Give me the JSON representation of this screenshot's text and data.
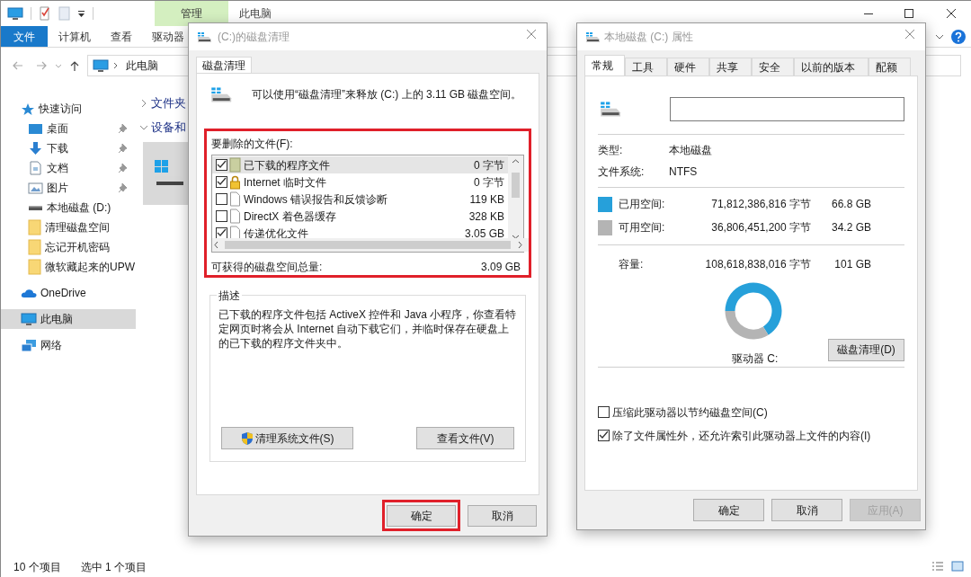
{
  "explorer": {
    "ribbon_header": {
      "context_group": "管理",
      "title": "此电脑"
    },
    "ribbon_tabs": [
      {
        "label": "文件",
        "kind": "file-menu"
      },
      {
        "label": "计算机",
        "kind": "tab"
      },
      {
        "label": "查看",
        "kind": "tab"
      },
      {
        "label": "驱动器",
        "kind": "tab"
      }
    ],
    "address": "此电脑",
    "nav": [
      {
        "label": "快速访问",
        "kind": "star",
        "selected": false,
        "children": [
          {
            "label": "桌面",
            "kind": "desktop",
            "pinned": true,
            "selected": false
          },
          {
            "label": "下载",
            "kind": "download",
            "pinned": true,
            "selected": false
          },
          {
            "label": "文档",
            "kind": "document",
            "pinned": true,
            "selected": false
          },
          {
            "label": "图片",
            "kind": "pictures",
            "pinned": true,
            "selected": false
          },
          {
            "label": "本地磁盘 (D:)",
            "kind": "drive",
            "pinned": false,
            "selected": false
          },
          {
            "label": "清理磁盘空间",
            "kind": "folder",
            "pinned": false,
            "selected": false
          },
          {
            "label": "忘记开机密码",
            "kind": "folder",
            "pinned": false,
            "selected": false
          },
          {
            "label": "微软藏起来的UPW",
            "kind": "folder",
            "pinned": false,
            "selected": false
          }
        ]
      },
      {
        "label": "OneDrive",
        "kind": "cloud",
        "selected": false
      },
      {
        "label": "此电脑",
        "kind": "pc",
        "selected": true
      },
      {
        "label": "网络",
        "kind": "network",
        "selected": false
      }
    ],
    "sections": [
      {
        "label": "文件夹",
        "expanded": false
      },
      {
        "label": "设备和",
        "expanded": true
      }
    ],
    "drive_tile": {
      "selected": true
    },
    "status": [
      "10 个项目",
      "选中 1 个项目"
    ]
  },
  "cleanup_dialog": {
    "title": "(C:)的磁盘清理",
    "tabs": [
      {
        "label": "磁盘清理",
        "selected": true
      }
    ],
    "summary": "可以使用“磁盘清理”来释放 (C:) 上的 3.11 GB 磁盘空间。",
    "files_highlighted": true,
    "files_label": "要删除的文件(F):",
    "files": [
      {
        "kind": "package",
        "name": "已下载的程序文件",
        "size": "0 字节",
        "checked": true,
        "selected": true
      },
      {
        "kind": "lock",
        "name": "Internet 临时文件",
        "size": "0 字节",
        "checked": true,
        "selected": false
      },
      {
        "kind": "file",
        "name": "Windows 错误报告和反馈诊断",
        "size": "119 KB",
        "checked": false,
        "selected": false
      },
      {
        "kind": "file",
        "name": "DirectX 着色器缓存",
        "size": "328 KB",
        "checked": false,
        "selected": false
      },
      {
        "kind": "file",
        "name": "传递优化文件",
        "size": "3.05 GB",
        "checked": true,
        "selected": false
      }
    ],
    "total_label": "可获得的磁盘空间总量:",
    "total": "3.09 GB",
    "description_title": "描述",
    "description": "已下载的程序文件包括 ActiveX 控件和 Java 小程序，你查看特定网页时将会从 Internet 自动下载它们，并临时保存在硬盘上的已下载的程序文件夹中。",
    "buttons": [
      {
        "label": "清理系统文件(S)",
        "kind": "shield"
      },
      {
        "label": "查看文件(V)",
        "kind": "plain"
      }
    ],
    "footer_buttons": [
      {
        "label": "确定",
        "highlighted": true
      },
      {
        "label": "取消",
        "highlighted": false
      }
    ]
  },
  "properties_dialog": {
    "title": "本地磁盘 (C:) 属性",
    "tabs": [
      {
        "label": "常规",
        "selected": true
      },
      {
        "label": "工具",
        "selected": false
      },
      {
        "label": "硬件",
        "selected": false
      },
      {
        "label": "共享",
        "selected": false
      },
      {
        "label": "安全",
        "selected": false
      },
      {
        "label": "以前的版本",
        "selected": false
      },
      {
        "label": "配额",
        "selected": false
      }
    ],
    "info": [
      {
        "label": "类型:",
        "value": "本地磁盘"
      },
      {
        "label": "文件系统:",
        "value": "NTFS"
      }
    ],
    "space": [
      {
        "label": "已用空间:",
        "bytes": "71,812,386,816 字节",
        "size": "66.8 GB",
        "color": "#26a0da"
      },
      {
        "label": "可用空间:",
        "bytes": "36,806,451,200 字节",
        "size": "34.2 GB",
        "color": "#b4b4b4"
      }
    ],
    "capacity": {
      "label": "容量:",
      "bytes": "108,618,838,016 字节",
      "size": "101 GB"
    },
    "chart_data": {
      "type": "donut",
      "values": [
        66.8,
        34.2
      ]
    },
    "drive_label": "驱动器 C:",
    "cleanup_button": "磁盘清理(D)",
    "options": [
      {
        "label": "压缩此驱动器以节约磁盘空间(C)",
        "checked": false
      },
      {
        "label": "除了文件属性外，还允许索引此驱动器上文件的内容(I)",
        "checked": true
      }
    ],
    "footer_buttons": [
      {
        "label": "确定",
        "disabled": false
      },
      {
        "label": "取消",
        "disabled": false
      },
      {
        "label": "应用(A)",
        "disabled": true
      }
    ]
  }
}
